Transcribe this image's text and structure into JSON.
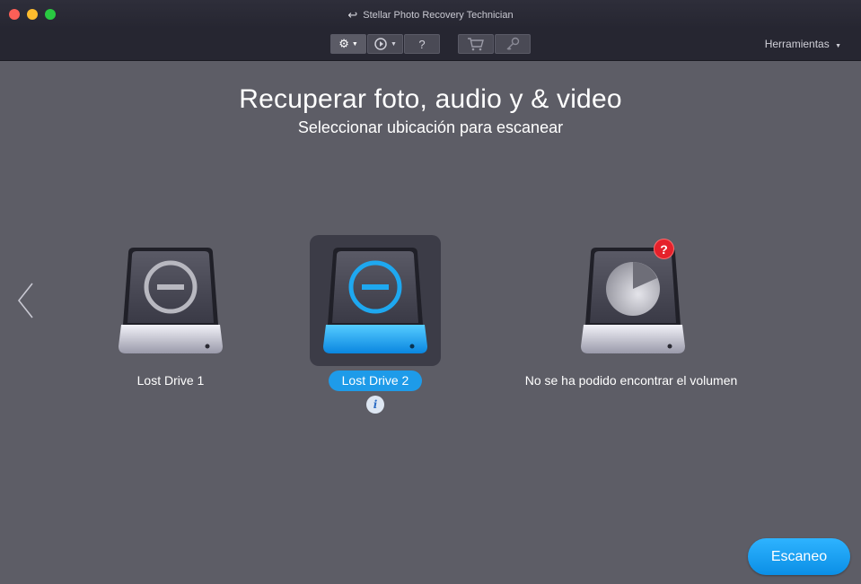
{
  "window": {
    "title": "Stellar Photo Recovery Technician"
  },
  "toolbar": {
    "help_label": "?",
    "tools_menu_label": "Herramientas"
  },
  "main": {
    "heading": "Recuperar foto, audio y & video",
    "subheading": "Seleccionar ubicación para escanear"
  },
  "drives": [
    {
      "label": "Lost Drive 1",
      "selected": false,
      "icon": "external-drive-unmounted-icon"
    },
    {
      "label": "Lost Drive 2",
      "selected": true,
      "icon": "external-drive-unmounted-icon",
      "accent": "#1e9be9"
    },
    {
      "label": "No se ha podido encontrar el volumen",
      "selected": false,
      "icon": "external-drive-unknown-icon",
      "badge": "?"
    }
  ],
  "info_badge": "i",
  "scan_button": {
    "label": "Escaneo"
  },
  "colors": {
    "background": "#5d5d66",
    "titlebar": "#262631",
    "accent": "#1e9be9",
    "badge_red": "#e5212b"
  }
}
